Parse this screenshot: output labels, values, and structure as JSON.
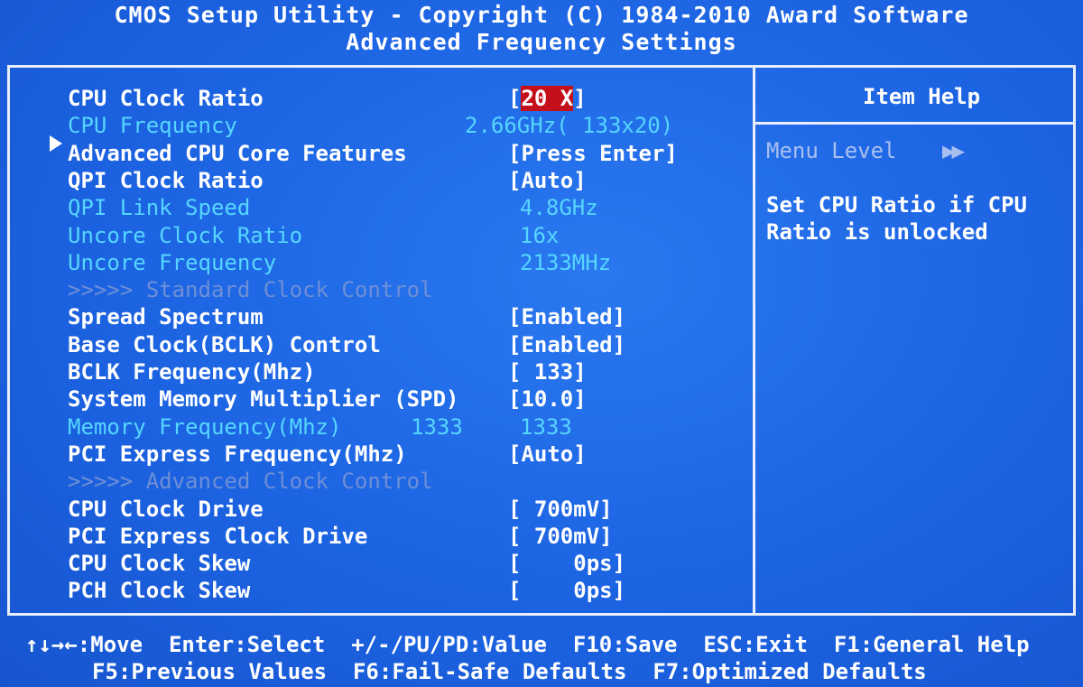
{
  "header": {
    "line1": "CMOS Setup Utility - Copyright (C) 1984-2010 Award Software",
    "line2": "Advanced Frequency Settings"
  },
  "items": [
    {
      "label": "CPU Clock Ratio",
      "value_prefix": "[",
      "value_selected": "20 X",
      "value_suffix": "]",
      "style": "white"
    },
    {
      "label": "CPU Frequency",
      "value": "2.66GHz( 133x20)",
      "style": "cyan"
    },
    {
      "label": "Advanced CPU Core Features",
      "value": "[Press Enter]",
      "style": "white",
      "submenu": true
    },
    {
      "label": "QPI Clock Ratio",
      "value": "[Auto]",
      "style": "white"
    },
    {
      "label": "QPI Link Speed",
      "value": "4.8GHz",
      "style": "cyan"
    },
    {
      "label": "Uncore Clock Ratio",
      "value": "16x",
      "style": "cyan"
    },
    {
      "label": "Uncore Frequency",
      "value": "2133MHz",
      "style": "cyan"
    },
    {
      "label": ">>>>> Standard Clock Control",
      "value": "",
      "style": "gray"
    },
    {
      "label": "Spread Spectrum",
      "value": "[Enabled]",
      "style": "white"
    },
    {
      "label": "Base Clock(BCLK) Control",
      "value": "[Enabled]",
      "style": "white"
    },
    {
      "label": "BCLK Frequency(Mhz)",
      "value": "[ 133]",
      "style": "white"
    },
    {
      "label": "System Memory Multiplier (SPD)",
      "value": "[10.0]",
      "style": "white"
    },
    {
      "label": "Memory Frequency(Mhz)",
      "extra": "1333",
      "value": "1333",
      "style": "cyan"
    },
    {
      "label": "PCI Express Frequency(Mhz)",
      "value": "[Auto]",
      "style": "white"
    },
    {
      "label": ">>>>> Advanced Clock Control",
      "value": "",
      "style": "gray"
    },
    {
      "label": "CPU Clock Drive",
      "value": "[ 700mV]",
      "style": "white"
    },
    {
      "label": "PCI Express Clock Drive",
      "value": "[ 700mV]",
      "style": "white"
    },
    {
      "label": "CPU Clock Skew",
      "value": "[    0ps]",
      "style": "white"
    },
    {
      "label": "PCH Clock Skew",
      "value": "[    0ps]",
      "style": "white"
    }
  ],
  "help": {
    "title": "Item Help",
    "menu_level_label": "Menu Level",
    "menu_level_arrows": "▶▶",
    "text_line1": "Set CPU Ratio if CPU",
    "text_line2": "Ratio is unlocked"
  },
  "footer": {
    "line1": "↑↓→←:Move  Enter:Select  +/-/PU/PD:Value  F10:Save  ESC:Exit  F1:General Help",
    "line2": "F5:Previous Values  F6:Fail-Safe Defaults  F7:Optimized Defaults"
  },
  "colors": {
    "background": "#1a62e0",
    "selected_bg": "#c4101a",
    "cyan_text": "#56d6ff",
    "gray_text": "#6f8fd6"
  }
}
